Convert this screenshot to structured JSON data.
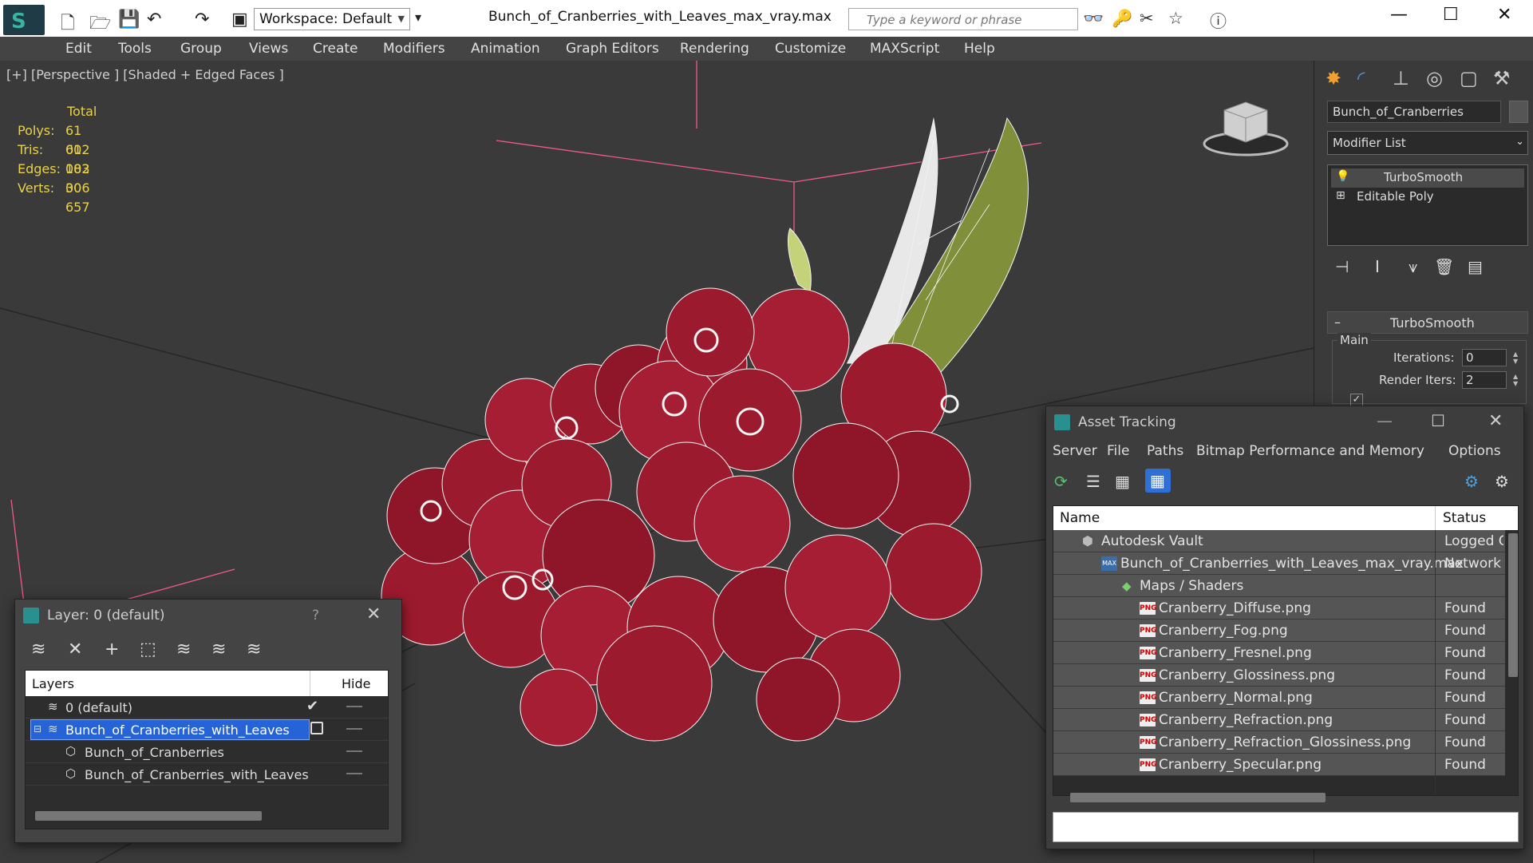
{
  "titlebar": {
    "workspace_label": "Workspace: Default",
    "document_title": "Bunch_of_Cranberries_with_Leaves_max_vray.max",
    "search_placeholder": "Type a keyword or phrase"
  },
  "menu": [
    "Edit",
    "Tools",
    "Group",
    "Views",
    "Create",
    "Modifiers",
    "Animation",
    "Graph Editors",
    "Rendering",
    "Customize",
    "MAXScript",
    "Help"
  ],
  "viewport": {
    "label": "[+] [Perspective ] [Shaded + Edged Faces ]",
    "stats": {
      "header": "Total",
      "rows": [
        {
          "key": "Polys:",
          "value": "61 002"
        },
        {
          "key": "Tris:",
          "value": "61 002"
        },
        {
          "key": "Edges:",
          "value": "183 006"
        },
        {
          "key": "Verts:",
          "value": "30 657"
        }
      ]
    },
    "colors": {
      "berry": "#9c1a2e",
      "leaf": "#7f8f3a",
      "wire": "#f4f4f4",
      "grid": "#f05a8a"
    }
  },
  "command_panel": {
    "object_name": "Bunch_of_Cranberries",
    "modifier_list": "Modifier List",
    "stack": [
      "TurboSmooth",
      "Editable Poly"
    ],
    "rollout_title": "TurboSmooth",
    "group_label": "Main",
    "iterations_label": "Iterations:",
    "iterations_value": "0",
    "render_iters_label": "Render Iters:",
    "render_iters_value": "2"
  },
  "layer_dialog": {
    "title": "Layer: 0 (default)",
    "help": "?",
    "col_layers": "Layers",
    "col_hide": "Hide",
    "rows": [
      "0 (default)",
      "Bunch_of_Cranberries_with_Leaves",
      "Bunch_of_Cranberries",
      "Bunch_of_Cranberries_with_Leaves"
    ]
  },
  "asset_dialog": {
    "title": "Asset Tracking",
    "menu": [
      "Server",
      "File",
      "Paths",
      "Bitmap Performance and Memory",
      "Options"
    ],
    "col_name": "Name",
    "col_status": "Status",
    "rows": [
      {
        "name": "Autodesk Vault",
        "status": "Logged Out"
      },
      {
        "name": "Bunch_of_Cranberries_with_Leaves_max_vray.max",
        "status": "Network"
      },
      {
        "name": "Maps / Shaders",
        "status": ""
      },
      {
        "name": "Cranberry_Diffuse.png",
        "status": "Found"
      },
      {
        "name": "Cranberry_Fog.png",
        "status": "Found"
      },
      {
        "name": "Cranberry_Fresnel.png",
        "status": "Found"
      },
      {
        "name": "Cranberry_Glossiness.png",
        "status": "Found"
      },
      {
        "name": "Cranberry_Normal.png",
        "status": "Found"
      },
      {
        "name": "Cranberry_Refraction.png",
        "status": "Found"
      },
      {
        "name": "Cranberry_Refraction_Glossiness.png",
        "status": "Found"
      },
      {
        "name": "Cranberry_Specular.png",
        "status": "Found"
      }
    ]
  }
}
